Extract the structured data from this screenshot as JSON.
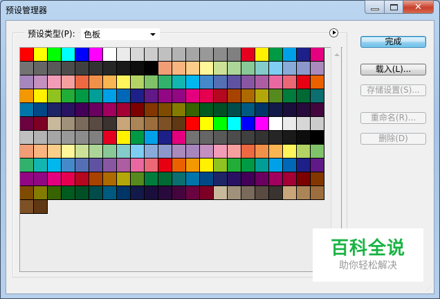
{
  "window": {
    "title": "预设管理器",
    "minimize": "—",
    "maximize": "□",
    "close": "✕"
  },
  "preset_type": {
    "label": "预设类型(P):",
    "value": "色板"
  },
  "buttons": {
    "done": "完成",
    "load": "载入(L)...",
    "save": "存储设置(S)...",
    "rename": "重命名(R)...",
    "delete": "删除(D)"
  },
  "watermark": {
    "title": "百科全说",
    "subtitle": "助你轻松解决"
  },
  "swatch_repeat": 2,
  "swatches": [
    "#FF0000",
    "#FFFF00",
    "#00FF00",
    "#00FFFF",
    "#0000FF",
    "#FF00FF",
    "#FFFFFF",
    "#EBEBEB",
    "#D7D7D7",
    "#CCCCCC",
    "#C0C0C0",
    "#B3B3B3",
    "#A6A6A6",
    "#999999",
    "#8C8C8C",
    "#808080",
    "#E60020",
    "#FFF100",
    "#009944",
    "#00A0E9",
    "#1D2088",
    "#E4007F",
    "#737373",
    "#666666",
    "#595959",
    "#4C4C4C",
    "#404040",
    "#333333",
    "#262626",
    "#1A1A1A",
    "#0D0D0D",
    "#000000",
    "#F19D76",
    "#F8B580",
    "#FACD89",
    "#FFF799",
    "#CCE198",
    "#ACD598",
    "#89C997",
    "#84CCC9",
    "#7ECEF4",
    "#88ABDA",
    "#8C97CB",
    "#AA89BD",
    "#A686BC",
    "#C490BF",
    "#F29CB7",
    "#F5A09F",
    "#EC6941",
    "#F19149",
    "#F8B551",
    "#FFF45C",
    "#B3D465",
    "#80C269",
    "#32B16C",
    "#13B5B1",
    "#00B7EE",
    "#448ACA",
    "#556FB5",
    "#5F52A0",
    "#8957A1",
    "#AD5DA1",
    "#EA68A2",
    "#EB6877",
    "#E60012",
    "#EB6100",
    "#F39800",
    "#FFF100",
    "#8FC31F",
    "#22AC38",
    "#009944",
    "#009E96",
    "#00A0E9",
    "#0068B7",
    "#1D2088",
    "#601986",
    "#920783",
    "#920783",
    "#E4007F",
    "#E5004F",
    "#B5071F",
    "#A84200",
    "#AC6A00",
    "#B4A70A",
    "#558A1F",
    "#007D3C",
    "#006934",
    "#0A6F6E",
    "#0075A9",
    "#004986",
    "#1D2567",
    "#2A1262",
    "#420058",
    "#6A005F",
    "#A1005F",
    "#A40035",
    "#7D0000",
    "#833600",
    "#7F4B00",
    "#837C00",
    "#376300",
    "#005B1F",
    "#004F25",
    "#004C4A",
    "#005A80",
    "#003567",
    "#131A49",
    "#1A0F3C",
    "#280A3C",
    "#44053F",
    "#6A0340",
    "#7D0024",
    "#C8B89C",
    "#A0917B",
    "#7A6A5C",
    "#594A42",
    "#3A3330",
    "#C9A57A",
    "#AB8558",
    "#9C6E3D",
    "#7D5025",
    "#603813"
  ]
}
